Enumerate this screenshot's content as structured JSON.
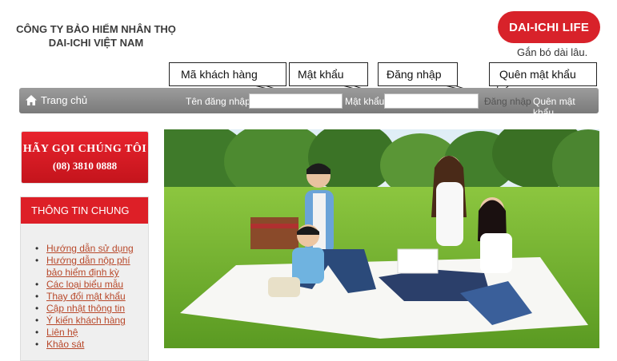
{
  "company": {
    "line1": "CÔNG TY BẢO HIỂM NHÂN THỌ",
    "line2": "DAI-ICHI VIỆT NAM"
  },
  "brand": {
    "logo_text": "DAI-ICHI LIFE",
    "slogan": "Gắn bó dài lâu.",
    "color": "#d8222a"
  },
  "callouts": {
    "customer_id": "Mã khách hàng",
    "password": "Mật khẩu",
    "login": "Đăng nhập",
    "forgot": "Quên mật khẩu"
  },
  "navbar": {
    "home_icon": "home-icon",
    "home_label": "Trang chủ",
    "username_label": "Tên đăng nhập",
    "username_value": "",
    "password_label": "Mật khẩu",
    "password_value": "",
    "login_label": "Đăng nhập",
    "forgot_label": "Quên mật khẩu"
  },
  "call_us": {
    "title": "HÃY GỌI CHÚNG TÔI",
    "phone": "(08) 3810 0888"
  },
  "info": {
    "heading": "THÔNG TIN CHUNG",
    "links": [
      "Hướng dẫn sử dụng",
      "Hướng dẫn nộp phí bảo hiểm định kỳ",
      "Các loại biểu mẫu",
      "Thay đổi mật khẩu",
      "Cập nhật thông tin",
      "Ý kiến khách hàng",
      "Liên hệ",
      "Khảo sát"
    ]
  },
  "hero": {
    "image": "family-picnic-photo"
  }
}
